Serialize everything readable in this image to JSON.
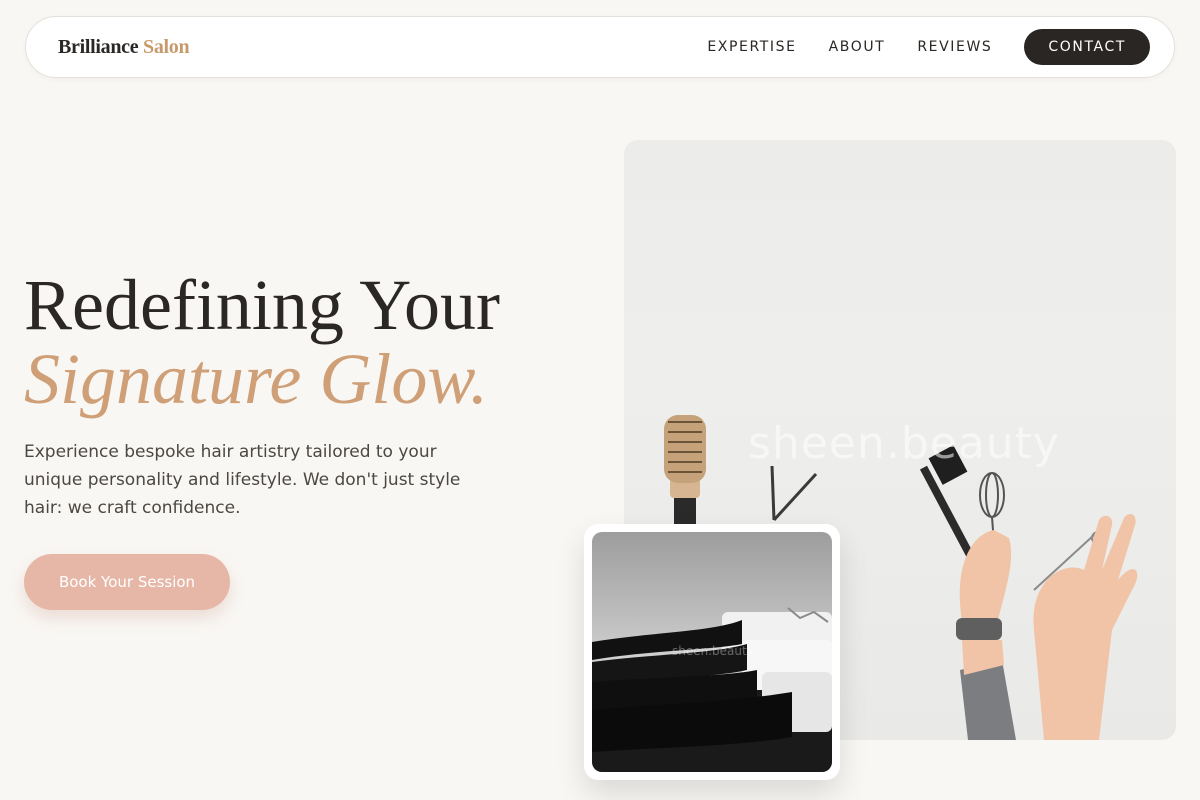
{
  "nav": {
    "logo_part1": "Brilliance",
    "logo_part2": "Salon",
    "links": [
      "EXPERTISE",
      "ABOUT",
      "REVIEWS"
    ],
    "cta": "CONTACT"
  },
  "hero": {
    "title_line1": "Redefining Your",
    "title_line2": "Signature Glow.",
    "description": "Experience bespoke hair artistry tailored to your unique personality and lifestyle. We don't just style hair: we craft confidence.",
    "button": "Book Your Session"
  },
  "images": {
    "main_watermark": "sheen.beauty",
    "inset_watermark": "sheen.beauty"
  },
  "colors": {
    "accent": "#cfa077",
    "button": "#e6b6a7",
    "dark": "#2a2624",
    "background": "#f9f7f4"
  }
}
